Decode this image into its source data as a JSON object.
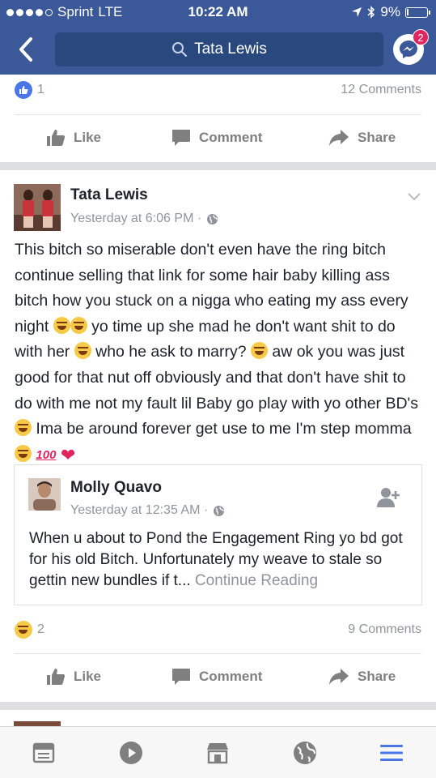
{
  "status_bar": {
    "carrier": "Sprint",
    "network": "LTE",
    "time": "10:22 AM",
    "battery_percent": "9%",
    "battery_level": 0.09
  },
  "nav": {
    "search_text": "Tata Lewis",
    "messenger_badge": "2"
  },
  "prev_post": {
    "like_count": "1",
    "comments": "12 Comments"
  },
  "actions": {
    "like": "Like",
    "comment": "Comment",
    "share": "Share"
  },
  "post": {
    "author": "Tata Lewis",
    "time": "Yesterday at 6:06 PM ·",
    "text_1": "This bitch so miserable don't even have the ring bitch continue selling that link for some hair baby killing ass bitch how you stuck on a nigga who eating my ass every night ",
    "text_2": " yo time up she mad he don't want shit to do with her ",
    "text_3": " who he ask to marry? ",
    "text_4": " aw ok you was just good for that nut off obviously and that don't have shit to do with me not my fault lil Baby go play with yo other BD's ",
    "text_5": " Ima be around forever get use to me I'm step momma ",
    "hundred": "100",
    "reaction_count": "2",
    "comments": "9 Comments"
  },
  "shared_post": {
    "author": "Molly Quavo",
    "time": "Yesterday at 12:35 AM ·",
    "text": "When u about to Pond the Engagement Ring yo bd got for his old Bitch. Unfortunately my weave to stale so gettin new bundles if t... ",
    "continue_label": "Continue Reading"
  },
  "colors": {
    "brand": "#3b5998",
    "search_bg": "#29487d",
    "badge": "#e0245e",
    "link_blue": "#4a76e8",
    "tab_active": "#4a76e8"
  },
  "icons": [
    "back-arrow-icon",
    "search-icon",
    "messenger-icon",
    "like-icon",
    "comment-icon",
    "share-icon",
    "globe-icon",
    "chevron-down-icon",
    "add-friend-icon",
    "haha-reaction-icon",
    "news-feed-icon",
    "video-icon",
    "marketplace-icon",
    "notifications-globe-icon",
    "menu-icon"
  ]
}
